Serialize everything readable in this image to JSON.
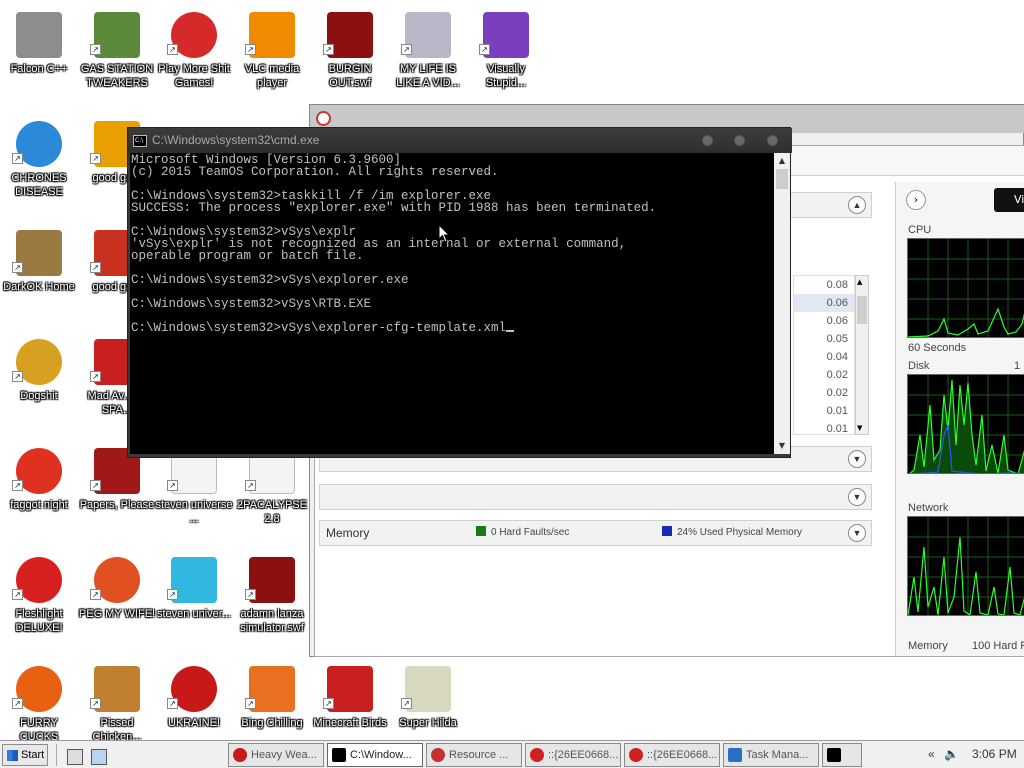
{
  "desktop_icons": [
    {
      "label": "Falcon C++",
      "icon": "recycle-bin-icon",
      "color": "#8d8d8d"
    },
    {
      "label": "GAS STATION TWEAKERS",
      "icon": "plant-pot-icon",
      "color": "#5a8a3a"
    },
    {
      "label": "Play More Shit Games!",
      "icon": "popcap-icon",
      "color": "#d62a2a"
    },
    {
      "label": "VLC media player",
      "icon": "vlc-cone-icon",
      "color": "#f08a00"
    },
    {
      "label": "BURGIN OUT.swf",
      "icon": "flash-icon",
      "color": "#8b1010"
    },
    {
      "label": "MY LIFE IS LIKE A VID...",
      "icon": "gamepad-icon",
      "color": "#b8b8c8"
    },
    {
      "label": "Visually Stupid...",
      "icon": "visual-studio-icon",
      "color": "#7a3fbf"
    },
    {
      "label": "CHRONES DISEASE",
      "icon": "chrome-icon",
      "color": "#2a8ad8"
    },
    {
      "label": "good ga...",
      "icon": "game-box-icon",
      "color": "#e8a000"
    },
    {
      "label": "DarkOK Home",
      "icon": "money-bag-icon",
      "color": "#9a7a40"
    },
    {
      "label": "good ga...",
      "icon": "gate-icon",
      "color": "#c83020"
    },
    {
      "label": "Dogshit",
      "icon": "cpp-icon",
      "color": "#d8a020"
    },
    {
      "label": "Mad Av... IN SPA...",
      "icon": "angry-bird-icon",
      "color": "#c82020"
    },
    {
      "label": "faggot night",
      "icon": "p-icon",
      "color": "#e03020"
    },
    {
      "label": "Papers, Please",
      "icon": "eagle-emblem-icon",
      "color": "#a01818"
    },
    {
      "label": "steven universe ...",
      "icon": "blank-file-icon",
      "color": "#f4f4f4"
    },
    {
      "label": "2PACALYPSE 2.8",
      "icon": "blank-file-icon",
      "color": "#f4f4f4"
    },
    {
      "label": "Fleshlight DELUXE!",
      "icon": "red-furball-icon",
      "color": "#d82020"
    },
    {
      "label": "PEG MY WIFE!",
      "icon": "peggle-icon",
      "color": "#e05020"
    },
    {
      "label": "steven univer...",
      "icon": "diamond-icon",
      "color": "#30b8e0"
    },
    {
      "label": "adamn lanza simulator.swf",
      "icon": "flash-icon",
      "color": "#8b1010"
    },
    {
      "label": "FURRY CUCKS",
      "icon": "firefox-icon",
      "color": "#e86010"
    },
    {
      "label": "Pissed Chicken...",
      "icon": "seasons-bird-icon",
      "color": "#c08030"
    },
    {
      "label": "UKRAINE!",
      "icon": "radiation-icon",
      "color": "#c81818"
    },
    {
      "label": "Bing Chilling",
      "icon": "box-art-icon",
      "color": "#e87020"
    },
    {
      "label": "Minecraft Birds",
      "icon": "angry-bird-icon",
      "color": "#c82020"
    },
    {
      "label": "Super Hilda",
      "icon": "pixel-character-icon",
      "color": "#d8d8c0"
    }
  ],
  "cmd": {
    "title": "C:\\Windows\\system32\\cmd.exe",
    "icon_text": "C:\\",
    "lines": [
      "Microsoft Windows [Version 6.3.9600]",
      "(c) 2015 TeamOS Corporation. All rights reserved.",
      "",
      "C:\\Windows\\system32>taskkill /f /im explorer.exe",
      "SUCCESS: The process \"explorer.exe\" with PID 1988 has been terminated.",
      "",
      "C:\\Windows\\system32>vSys\\explr",
      "'vSys\\explr' is not recognized as an internal or external command,",
      "operable program or batch file.",
      "",
      "C:\\Windows\\system32>vSys\\explorer.exe",
      "",
      "C:\\Windows\\system32>vSys\\RTB.EXE",
      "",
      "C:\\Windows\\system32>vSys\\explorer-cfg-template.xml"
    ]
  },
  "resource_monitor": {
    "values": [
      "0.08",
      "0.06",
      "0.06",
      "0.05",
      "0.04",
      "0.02",
      "0.02",
      "0.01",
      "0.01"
    ],
    "selected_value_index": 1,
    "memory_section": {
      "title": "Memory",
      "hard_faults": "0 Hard Faults/sec",
      "used_physical": "24% Used Physical Memory",
      "hard_faults_color": "#1a7a1a",
      "used_color": "#1a2ab8"
    },
    "right_panel": {
      "view_label": "Vie",
      "cpu_label": "CPU",
      "cpu_time_label": "60 Seconds",
      "disk_label": "Disk",
      "disk_scale": "1",
      "network_label": "Network",
      "memory_label": "Memory",
      "memory_faults": "100 Hard Fa"
    }
  },
  "taskbar": {
    "start_label": "Start",
    "buttons": [
      {
        "label": "Heavy Wea...",
        "icon": "radiation-icon",
        "color": "#c81818",
        "active": false
      },
      {
        "label": "C:\\Window...",
        "icon": "cmd-icon",
        "color": "#000000",
        "active": true
      },
      {
        "label": "Resource ...",
        "icon": "resource-monitor-icon",
        "color": "#c83030",
        "active": false
      },
      {
        "label": "::{26EE0668...",
        "icon": "no-entry-icon",
        "color": "#d02020",
        "active": false
      },
      {
        "label": "::{26EE0668...",
        "icon": "no-entry-icon",
        "color": "#d02020",
        "active": false
      },
      {
        "label": "Task Mana...",
        "icon": "task-manager-icon",
        "color": "#2a70c0",
        "active": false
      }
    ],
    "clock": "3:06 PM"
  }
}
